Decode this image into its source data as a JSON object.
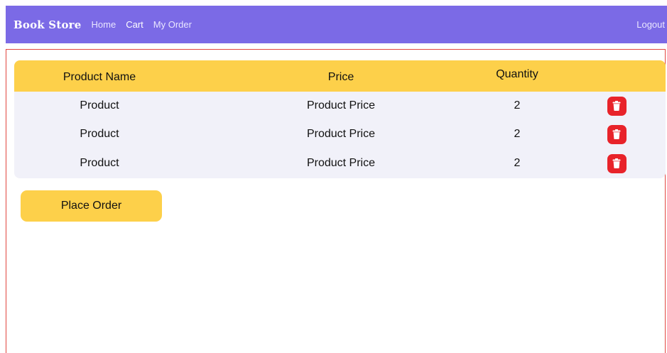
{
  "colors": {
    "nav_bg": "#7b6ae6",
    "accent": "#fdd04a",
    "delete": "#e8232a",
    "frame_border": "#e2463f",
    "table_bg": "#f1f1f9"
  },
  "navbar": {
    "brand": "Book Store",
    "links": [
      {
        "label": "Home"
      },
      {
        "label": "Cart"
      },
      {
        "label": "My Order"
      }
    ],
    "logout": "Logout"
  },
  "cart": {
    "headers": {
      "name": "Product Name",
      "price": "Price",
      "quantity": "Quantity"
    },
    "rows": [
      {
        "name": "Product",
        "price": "Product Price",
        "quantity": "2",
        "delete_icon": "trash-icon"
      },
      {
        "name": "Product",
        "price": "Product Price",
        "quantity": "2",
        "delete_icon": "trash-icon"
      },
      {
        "name": "Product",
        "price": "Product Price",
        "quantity": "2",
        "delete_icon": "trash-icon"
      }
    ]
  },
  "actions": {
    "place_order": "Place Order"
  }
}
